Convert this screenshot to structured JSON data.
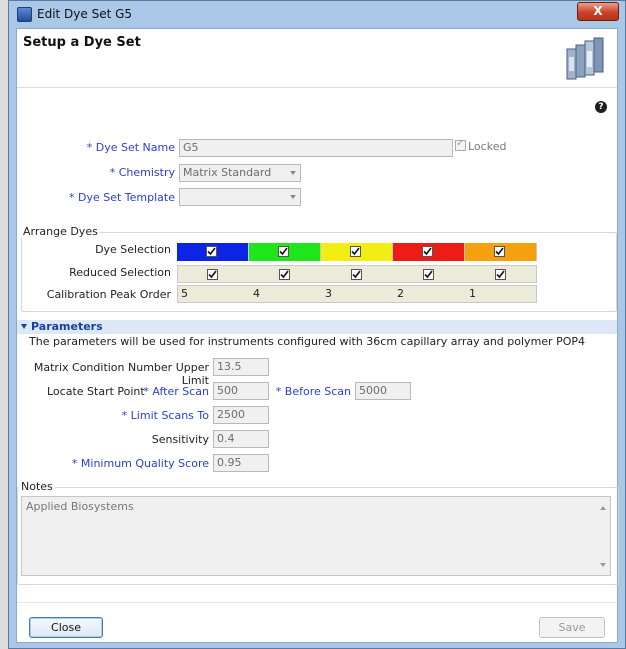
{
  "window": {
    "title": "Edit Dye Set G5",
    "close_glyph": "X"
  },
  "page_title": "Setup a Dye Set",
  "help_glyph": "?",
  "form": {
    "dye_set_name": {
      "label": "Dye Set Name",
      "value": "G5"
    },
    "locked_label": "Locked",
    "chemistry": {
      "label": "Chemistry",
      "value": "Matrix Standard"
    },
    "dye_set_template": {
      "label": "Dye Set Template",
      "value": ""
    },
    "required_mark": "*"
  },
  "arrange_dyes": {
    "title": "Arrange Dyes",
    "row_labels": {
      "dye_selection": "Dye Selection",
      "reduced_selection": "Reduced Selection",
      "calibration_peak_order": "Calibration Peak Order"
    },
    "dyes": [
      {
        "color": "#0b24e6",
        "selected": true,
        "reduced": true,
        "order": "5"
      },
      {
        "color": "#1fe61a",
        "selected": true,
        "reduced": true,
        "order": "4"
      },
      {
        "color": "#f2ee14",
        "selected": true,
        "reduced": true,
        "order": "3"
      },
      {
        "color": "#ee1c16",
        "selected": true,
        "reduced": true,
        "order": "2"
      },
      {
        "color": "#f5a10f",
        "selected": true,
        "reduced": true,
        "order": "1"
      }
    ]
  },
  "parameters": {
    "title": "Parameters",
    "description": "The parameters will be used for instruments configured with 36cm capillary array and polymer POP4",
    "matrix_condition": {
      "label": "Matrix Condition Number Upper Limit",
      "value": "13.5"
    },
    "locate_start_point": "Locate Start Point",
    "after_scan": {
      "label": "After Scan",
      "value": "500"
    },
    "before_scan": {
      "label": "Before Scan",
      "value": "5000"
    },
    "limit_scans": {
      "label": "Limit Scans To",
      "value": "2500"
    },
    "sensitivity": {
      "label": "Sensitivity",
      "value": "0.4"
    },
    "min_quality": {
      "label": "Minimum Quality Score",
      "value": "0.95"
    }
  },
  "notes": {
    "title": "Notes",
    "value": "Applied Biosystems"
  },
  "buttons": {
    "close": "Close",
    "save": "Save"
  }
}
